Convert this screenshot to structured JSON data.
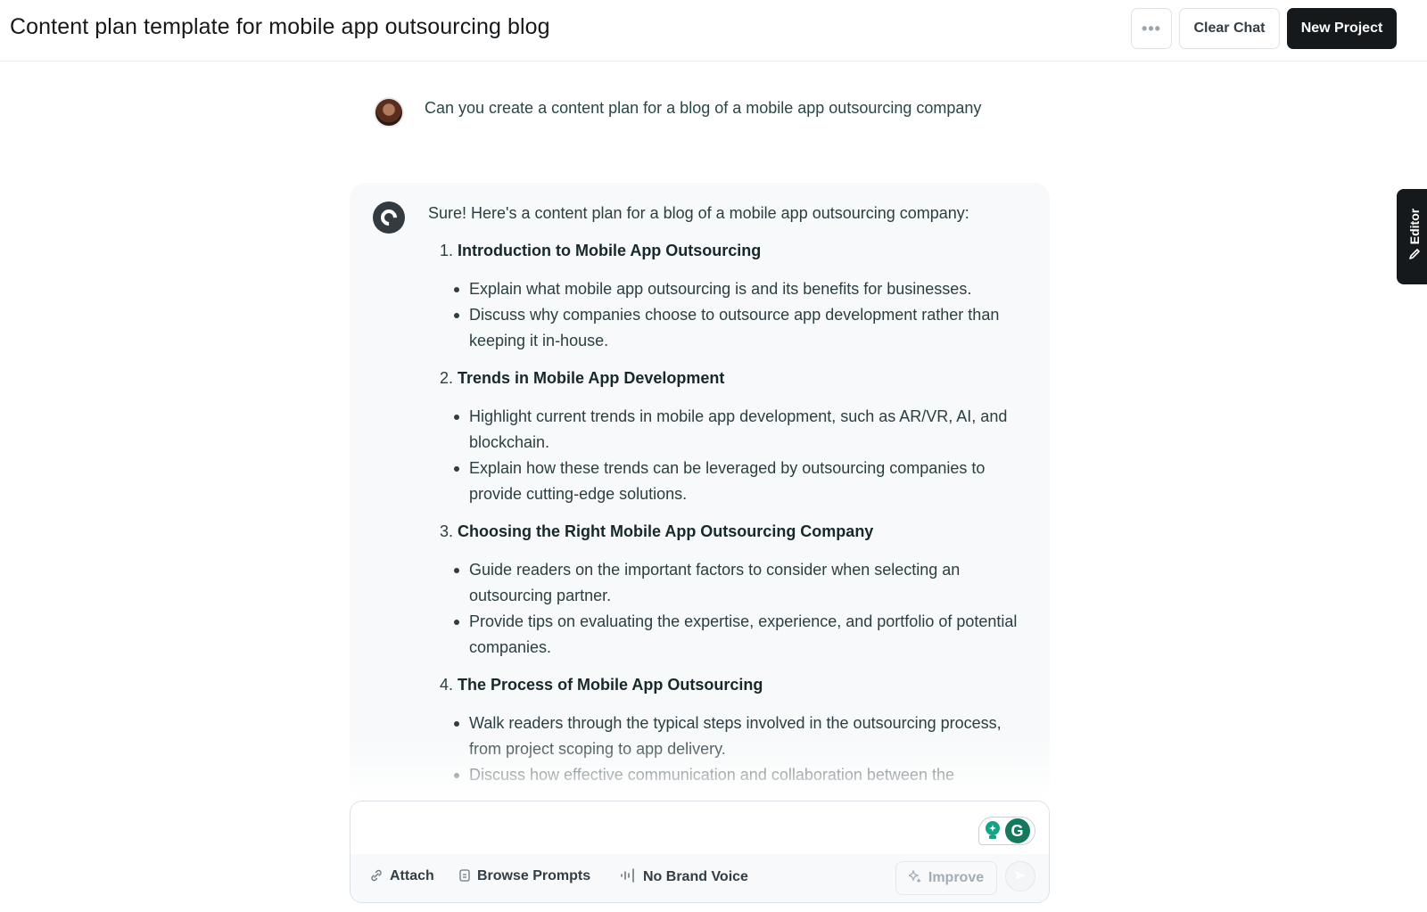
{
  "header": {
    "title": "Content plan template for mobile app outsourcing blog",
    "more_icon": "more-horizontal-icon",
    "more_label": "•••",
    "clear_label": "Clear Chat",
    "new_label": "New Project"
  },
  "user_message": {
    "avatar": "user-avatar-photo",
    "text": "Can you create a content plan for a blog of a mobile app outsourcing company"
  },
  "assistant_message": {
    "avatar_letter": "C",
    "intro": "Sure! Here's a content plan for a blog of a mobile app outsourcing company:",
    "sections": [
      {
        "num": "1.",
        "title": "Introduction to Mobile App Outsourcing",
        "bullets": [
          "Explain what mobile app outsourcing is and its benefits for businesses.",
          "Discuss why companies choose to outsource app development rather than keeping it in-house."
        ]
      },
      {
        "num": "2.",
        "title": "Trends in Mobile App Development",
        "bullets": [
          "Highlight current trends in mobile app development, such as AR/VR, AI, and blockchain.",
          "Explain how these trends can be leveraged by outsourcing companies to provide cutting-edge solutions."
        ]
      },
      {
        "num": "3.",
        "title": "Choosing the Right Mobile App Outsourcing Company",
        "bullets": [
          "Guide readers on the important factors to consider when selecting an outsourcing partner.",
          "Provide tips on evaluating the expertise, experience, and portfolio of potential companies."
        ]
      },
      {
        "num": "4.",
        "title": "The Process of Mobile App Outsourcing",
        "bullets": [
          "Walk readers through the typical steps involved in the outsourcing process, from project scoping to app delivery.",
          "Discuss how effective communication and collaboration between the"
        ]
      }
    ]
  },
  "editor_tab": {
    "label": "Editor",
    "icon": "pencil-icon"
  },
  "composer": {
    "placeholder": "",
    "value": "",
    "attach_label": "Attach",
    "prompts_label": "Browse Prompts",
    "brand_voice_label": "No Brand Voice",
    "improve_label": "Improve",
    "send_icon": "send-arrow-icon",
    "grammarly_letter": "G"
  },
  "colors": {
    "primary_dark": "#16191b",
    "card_bg": "#f7f9fa",
    "text": "#2c3e40",
    "grammarly_green": "#15795d"
  }
}
